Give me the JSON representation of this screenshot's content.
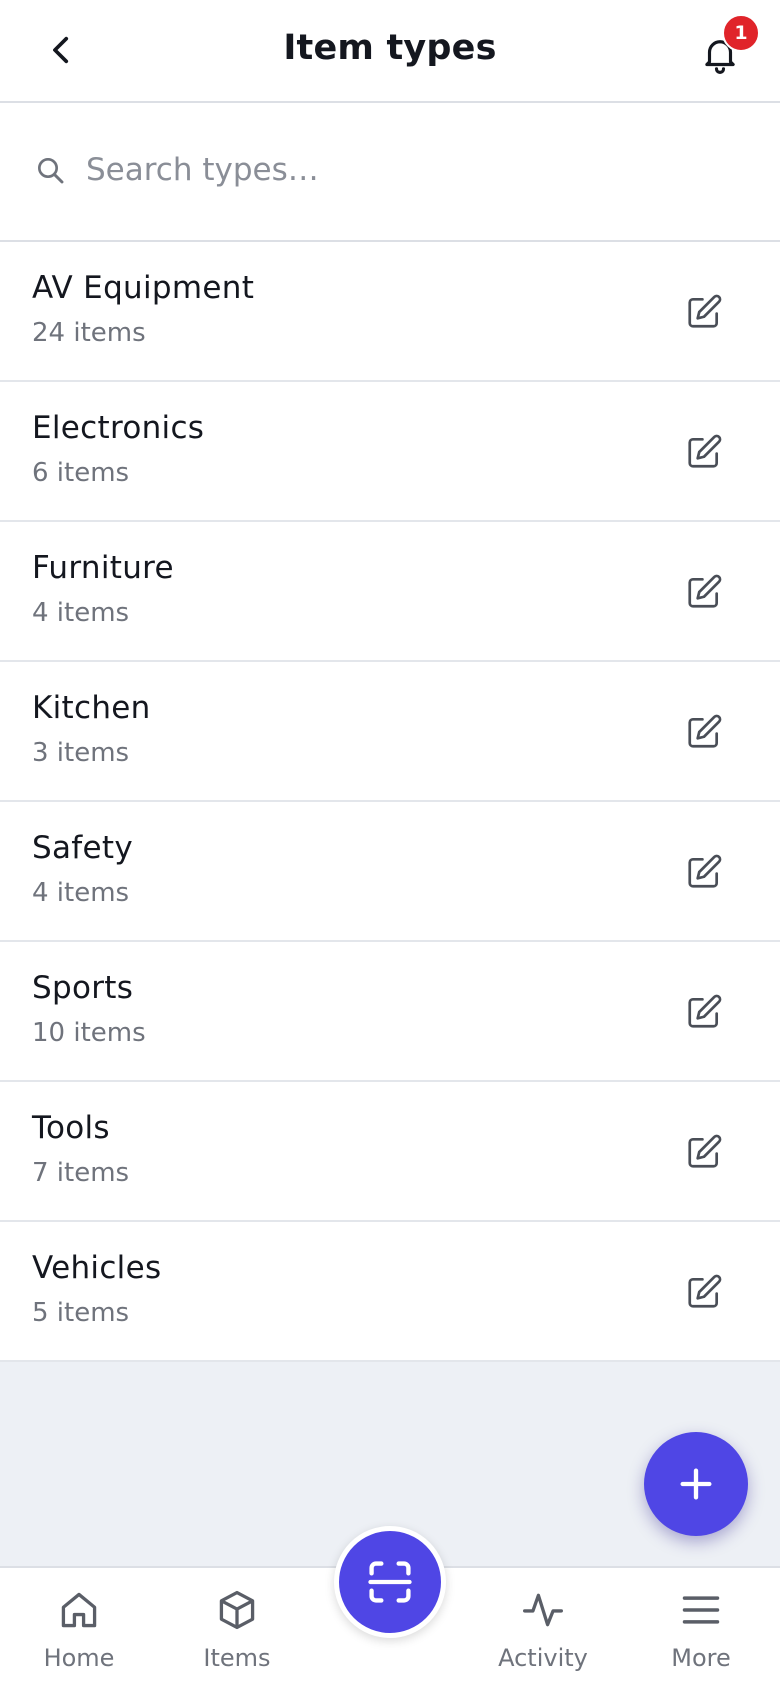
{
  "header": {
    "title": "Item types",
    "back_icon": "chevron-left-icon",
    "notification_icon": "bell-icon",
    "notification_count": "1"
  },
  "search": {
    "placeholder": "Search types…",
    "value": ""
  },
  "types": [
    {
      "name": "AV Equipment",
      "count": "24 items"
    },
    {
      "name": "Electronics",
      "count": "6 items"
    },
    {
      "name": "Furniture",
      "count": "4 items"
    },
    {
      "name": "Kitchen",
      "count": "3 items"
    },
    {
      "name": "Safety",
      "count": "4 items"
    },
    {
      "name": "Sports",
      "count": "10 items"
    },
    {
      "name": "Tools",
      "count": "7 items"
    },
    {
      "name": "Vehicles",
      "count": "5 items"
    }
  ],
  "fab": {
    "icon": "plus-icon"
  },
  "nav": {
    "home": "Home",
    "items": "Items",
    "scan_icon": "scan-icon",
    "activity": "Activity",
    "more": "More"
  },
  "colors": {
    "accent": "#4f46e5",
    "badge": "#e0242a",
    "background": "#edf0f5"
  }
}
